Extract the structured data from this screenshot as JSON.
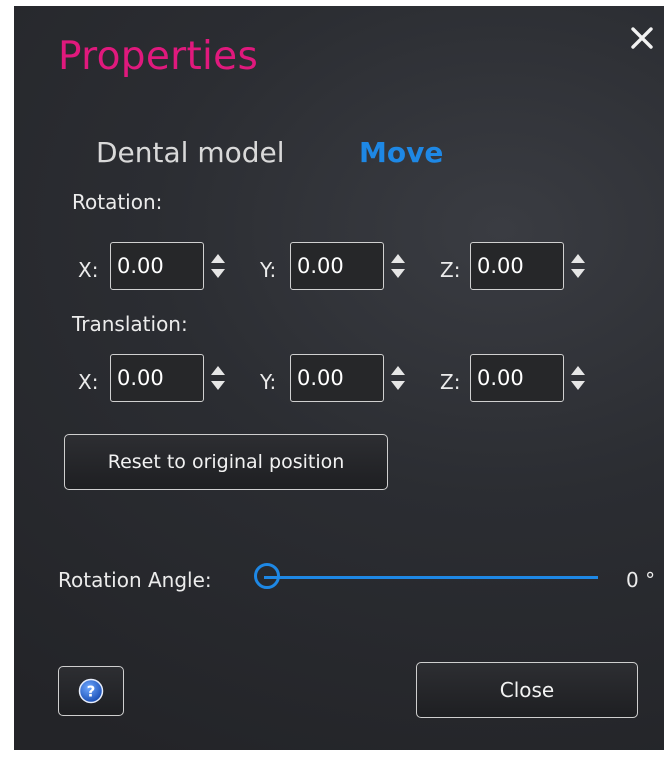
{
  "dialog": {
    "title": "Properties",
    "tabs": [
      {
        "label": "Dental model",
        "active": false
      },
      {
        "label": "Move",
        "active": true
      }
    ]
  },
  "rotation": {
    "label": "Rotation:",
    "x_label": "X:",
    "y_label": "Y:",
    "z_label": "Z:",
    "x": "0.00",
    "y": "0.00",
    "z": "0.00"
  },
  "translation": {
    "label": "Translation:",
    "x_label": "X:",
    "y_label": "Y:",
    "z_label": "Z:",
    "x": "0.00",
    "y": "0.00",
    "z": "0.00"
  },
  "reset_label": "Reset to original position",
  "rotation_angle": {
    "label": "Rotation Angle:",
    "value": 0,
    "value_text": "0 °"
  },
  "close_label": "Close",
  "icons": {
    "close": "close-icon",
    "help": "help-icon",
    "spinner": "spinner-arrows-icon"
  },
  "colors": {
    "title": "#e0197d",
    "accent": "#1e88e5",
    "panel": "#2b2d32"
  }
}
